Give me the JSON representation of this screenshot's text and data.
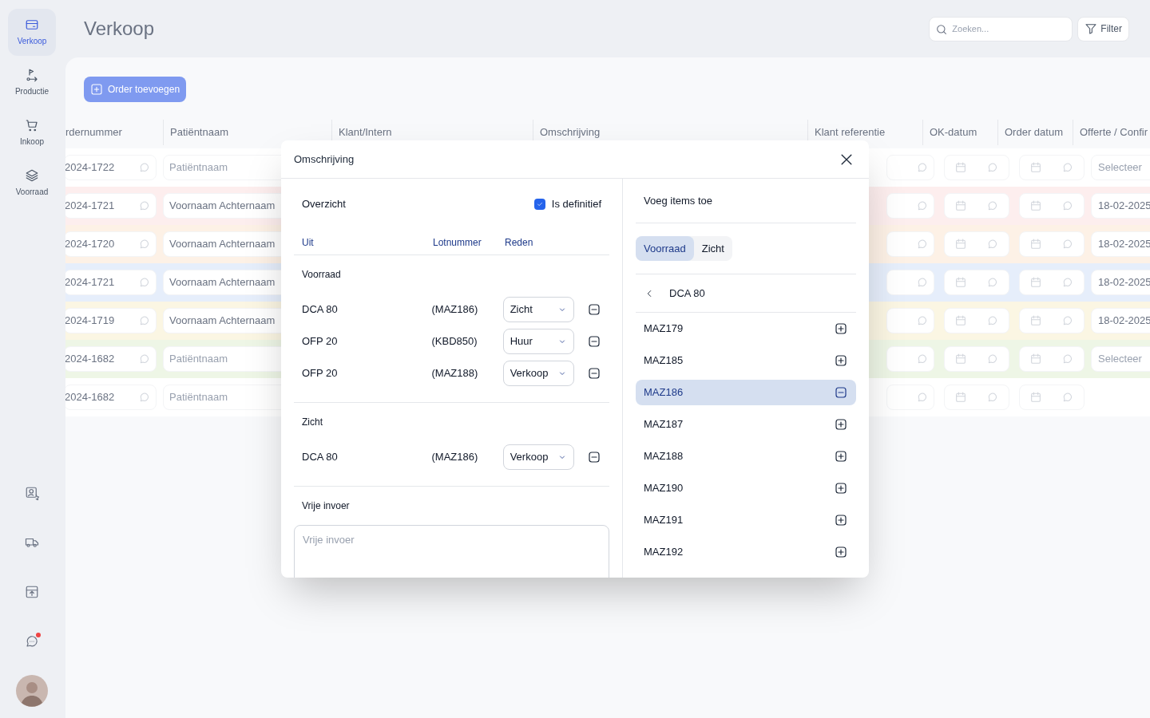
{
  "sidebar": {
    "items": [
      {
        "label": "Verkoop",
        "kind": "card",
        "selected": true
      },
      {
        "label": "Productie",
        "kind": "flow",
        "selected": false
      },
      {
        "label": "Inkoop",
        "kind": "cart",
        "selected": false
      },
      {
        "label": "Voorraad",
        "kind": "layers",
        "selected": false
      }
    ],
    "bottom_icons": [
      {
        "kind": "user"
      },
      {
        "kind": "truck"
      },
      {
        "kind": "box"
      },
      {
        "kind": "chat",
        "notification": true
      }
    ]
  },
  "page": {
    "title": "Verkoop",
    "search": {
      "placeholder": "Zoeken..."
    },
    "filter_button": "Filter",
    "add_button": "Order toevoegen"
  },
  "table": {
    "columns": [
      "rdernummer",
      "Patiëntnaam",
      "Klant/Intern",
      "Omschrijving",
      "Klant referentie",
      "OK-datum",
      "Order datum",
      "Offerte / Confir"
    ],
    "rows": [
      {
        "order": "2024-1722",
        "patient": "",
        "patient_placeholder": "Patiëntnaam",
        "offerte": "",
        "offerte_placeholder": "Selecteer",
        "color": "#ffffff"
      },
      {
        "order": "2024-1721",
        "patient": "Voornaam Achternaam",
        "offerte": "18-02-2025",
        "color": "#fdeeee"
      },
      {
        "order": "2024-1720",
        "patient": "Voornaam Achternaam",
        "offerte": "18-02-2025",
        "color": "#fdf1e6"
      },
      {
        "order": "2024-1721",
        "patient": "Voornaam Achternaam",
        "offerte": "18-02-2025",
        "color": "#e6eefb"
      },
      {
        "order": "2024-1719",
        "patient": "Voornaam Achternaam",
        "offerte": "18-02-2025",
        "color": "#fbf6e3"
      },
      {
        "order": "2024-1682",
        "patient": "",
        "patient_placeholder": "Patiëntnaam",
        "offerte": "",
        "offerte_placeholder": "Selecteer",
        "color": "#eef6e6"
      },
      {
        "order": "2024-1682",
        "patient": "",
        "patient_placeholder": "Patiëntnaam",
        "color": "#ffffff"
      }
    ]
  },
  "modal": {
    "title": "Omschrijving",
    "overview": {
      "title": "Overzicht",
      "definitive": {
        "label": "Is definitief",
        "checked": true
      },
      "columns": [
        "Uit",
        "Lotnummer",
        "Reden"
      ],
      "sections": [
        {
          "title": "Voorraad",
          "rows": [
            {
              "name": "DCA 80",
              "lot": "(MAZ186)",
              "reason": "Zicht"
            },
            {
              "name": "OFP 20",
              "lot": "(KBD850)",
              "reason": "Huur"
            },
            {
              "name": "OFP 20",
              "lot": "(MAZ188)",
              "reason": "Verkoop"
            }
          ]
        },
        {
          "title": "Zicht",
          "rows": [
            {
              "name": "DCA 80",
              "lot": "(MAZ186)",
              "reason": "Verkoop"
            }
          ]
        }
      ],
      "free_input": {
        "title": "Vrije invoer",
        "placeholder": "Vrije invoer"
      }
    },
    "add_items": {
      "title": "Voeg items toe",
      "tabs": [
        {
          "label": "Voorraad",
          "selected": true
        },
        {
          "label": "Zicht",
          "selected": false
        }
      ],
      "breadcrumb": "DCA 80",
      "items": [
        {
          "label": "MAZ179",
          "selected": false
        },
        {
          "label": "MAZ185",
          "selected": false
        },
        {
          "label": "MAZ186",
          "selected": true
        },
        {
          "label": "MAZ187",
          "selected": false
        },
        {
          "label": "MAZ188",
          "selected": false
        },
        {
          "label": "MAZ190",
          "selected": false
        },
        {
          "label": "MAZ191",
          "selected": false
        },
        {
          "label": "MAZ192",
          "selected": false
        }
      ]
    }
  }
}
